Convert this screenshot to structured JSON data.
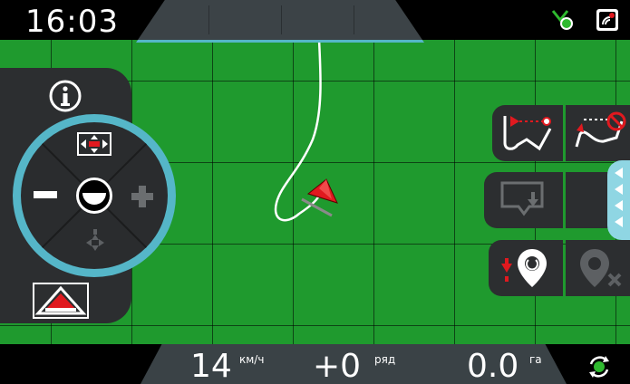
{
  "status_bar": {
    "time": "16:03",
    "gps_status_icon": "tractor-signal-icon",
    "receiver_icon": "antenna-icon"
  },
  "readouts": {
    "speed_value": "14",
    "speed_unit": "км/ч",
    "row_value": "+0",
    "row_unit": "ряд",
    "area_value": "0.0",
    "area_unit": "га"
  },
  "left_panel": {
    "info_button": "i",
    "dial": {
      "top": "expand-width-icon",
      "left": "minus-icon",
      "center": "section-half-icon",
      "right": "plus-icon",
      "bottom": "collapse-arrows-icon"
    },
    "implement_button": "tractor-view-icon"
  },
  "right_panel": {
    "set_a_point": "set-point-a-icon",
    "cancel_point": "cancel-point-icon",
    "record_boundary": "record-boundary-icon",
    "pin_marker": "place-marker-icon",
    "delete_marker": "delete-marker-icon"
  },
  "colors": {
    "field": "#1f9a2e",
    "accent": "#55b6c8",
    "alert": "#e0191f",
    "panel": "#2c2e30"
  },
  "bottom_right_icon": "sync-icon"
}
